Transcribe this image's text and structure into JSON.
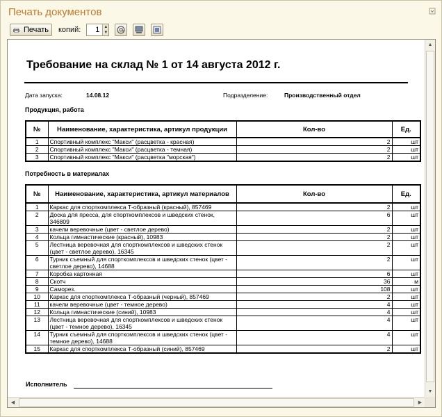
{
  "window": {
    "title": "Печать документов"
  },
  "toolbar": {
    "print_label": "Печать",
    "copies_label": "копий:",
    "copies_value": "1"
  },
  "document": {
    "title": "Требование на склад № 1 от 14 августа 2012 г.",
    "start_date_label": "Дата запуска:",
    "start_date_value": "14.08.12",
    "department_label": "Подразделение:",
    "department_value": "Производственный отдел",
    "products_section": "Продукция, работа",
    "products_headers": [
      "№",
      "Наименование, характеристика, артикул продукции",
      "Кол-во",
      "Ед."
    ],
    "products_rows": [
      {
        "n": "1",
        "name": "Спортивный комплекс \"Макси\" (расцветка - красная)",
        "qty": "2",
        "unit": "шт"
      },
      {
        "n": "2",
        "name": "Спортивный комплекс \"Макси\" (расцветка - темная)",
        "qty": "2",
        "unit": "шт"
      },
      {
        "n": "3",
        "name": "Спортивный комплекс \"Макси\" (расцветка \"морская\")",
        "qty": "2",
        "unit": "шт"
      }
    ],
    "materials_section": "Потребность в материалах",
    "materials_headers": [
      "№",
      "Наименование, характеристика, артикул материалов",
      "Кол-во",
      "Ед."
    ],
    "materials_rows": [
      {
        "n": "1",
        "name": "Каркас для спорткомплекса Т-образный (красный), 857469",
        "qty": "2",
        "unit": "шт"
      },
      {
        "n": "2",
        "name": "Доска для пресса, для спорткомплексов и шведских стенок, 346809",
        "qty": "6",
        "unit": "шт"
      },
      {
        "n": "3",
        "name": "качели веревочные (цвет - светлое дерево)",
        "qty": "2",
        "unit": "шт"
      },
      {
        "n": "4",
        "name": "Кольца гимнастические (красный), 10983",
        "qty": "2",
        "unit": "шт"
      },
      {
        "n": "5",
        "name": "Лестница веревочная для спорткомплексов и шведских стенок (цвет - светлое дерево), 16345",
        "qty": "2",
        "unit": "шт"
      },
      {
        "n": "6",
        "name": "Турник съемный для спорткомплексов и шведских стенок (цвет - светлое дерево), 14688",
        "qty": "2",
        "unit": "шт"
      },
      {
        "n": "7",
        "name": "Коробка картонная",
        "qty": "6",
        "unit": "шт"
      },
      {
        "n": "8",
        "name": "Скотч",
        "qty": "36",
        "unit": "м"
      },
      {
        "n": "9",
        "name": "Саморез.",
        "qty": "108",
        "unit": "шт"
      },
      {
        "n": "10",
        "name": "Каркас для спорткомплекса Т-образный (черный), 857469",
        "qty": "2",
        "unit": "шт"
      },
      {
        "n": "11",
        "name": "качели веревочные (цвет - темное дерево)",
        "qty": "4",
        "unit": "шт"
      },
      {
        "n": "12",
        "name": "Кольца гимнастические (синий), 10983",
        "qty": "4",
        "unit": "шт"
      },
      {
        "n": "13",
        "name": "Лестница веревочная для спорткомплексов и шведских стенок (цвет - темное дерево), 16345",
        "qty": "4",
        "unit": "шт"
      },
      {
        "n": "14",
        "name": "Турник съемный для спорткомплексов и шведских стенок (цвет - темное дерево), 14688",
        "qty": "4",
        "unit": "шт"
      },
      {
        "n": "15",
        "name": "Каркас для спорткомплекса Т-образный (синий), 857469",
        "qty": "2",
        "unit": "шт"
      }
    ],
    "executor_label": "Исполнитель"
  },
  "colors": {
    "title": "#c0792d",
    "background": "#fbf8e8"
  },
  "icons": [
    "printer-icon",
    "email-icon",
    "preview-icon",
    "settings-icon",
    "window-menu-icon"
  ]
}
